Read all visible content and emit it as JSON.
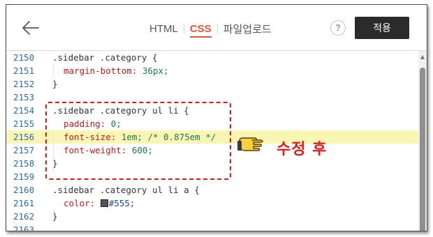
{
  "header": {
    "tabs": [
      {
        "label": "HTML",
        "active": false
      },
      {
        "label": "CSS",
        "active": true
      },
      {
        "label": "파일업로드",
        "active": false
      }
    ],
    "help_label": "?",
    "apply_label": "적용"
  },
  "code_lines": [
    {
      "num": "2150",
      "text": ".sidebar .category {"
    },
    {
      "num": "2151",
      "prop": "margin-bottom:",
      "val": " 36px;"
    },
    {
      "num": "2152",
      "text": "}"
    },
    {
      "num": "2153",
      "text": ""
    },
    {
      "num": "2154",
      "text": ".sidebar .category ul li {"
    },
    {
      "num": "2155",
      "prop": "padding:",
      "val": " 0;"
    },
    {
      "num": "2156",
      "prop": "font-size:",
      "val": " 1em;",
      "comment": " /* 0.875em */"
    },
    {
      "num": "2157",
      "prop": "font-weight:",
      "val": " 600;"
    },
    {
      "num": "2158",
      "text": "}"
    },
    {
      "num": "2159",
      "text": ""
    },
    {
      "num": "2160",
      "text": ".sidebar .category ul li a {"
    },
    {
      "num": "2161",
      "prop": "color:",
      "val": " #555;"
    },
    {
      "num": "2162",
      "text": "}"
    },
    {
      "num": "2163",
      "text": ""
    }
  ],
  "annotation": {
    "label": "수정 후",
    "color": "#e41b1b"
  },
  "colors": {
    "accent": "#e7543b",
    "apply_button": "#2b2b2b",
    "highlight": "#f9f6b3",
    "line_number": "#2a6bb5",
    "property": "#c41a1a",
    "value": "#1c7a4f"
  }
}
